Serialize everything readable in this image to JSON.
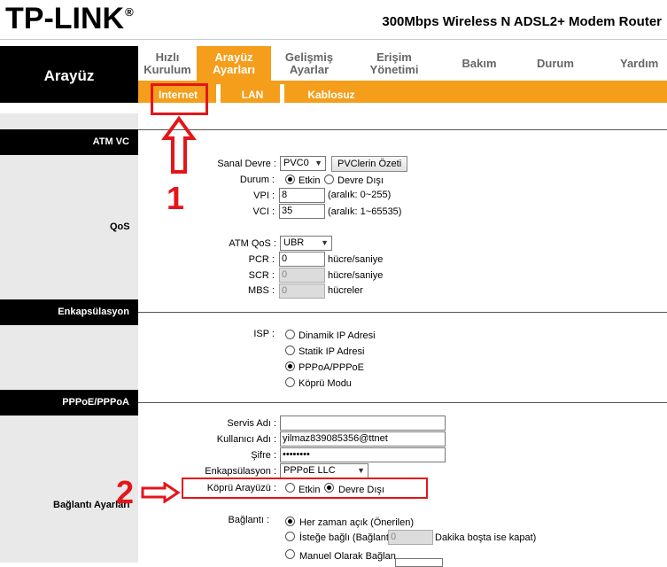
{
  "brand": {
    "logo": "TP-LINK",
    "reg": "®",
    "product": "300Mbps Wireless N ADSL2+ Modem Router"
  },
  "header": {
    "section_title": "Arayüz"
  },
  "nav": [
    {
      "line1": "Hızlı",
      "line2": "Kurulum"
    },
    {
      "line1": "Arayüz",
      "line2": "Ayarları"
    },
    {
      "line1": "Gelişmiş",
      "line2": "Ayarlar"
    },
    {
      "line1": "Erişim",
      "line2": "Yönetimi"
    },
    {
      "line1": "Bakım",
      "line2": ""
    },
    {
      "line1": "Durum",
      "line2": ""
    },
    {
      "line1": "Yardım",
      "line2": ""
    }
  ],
  "subnav": [
    "Internet",
    "LAN",
    "Kablosuz"
  ],
  "sections": {
    "atm": "ATM VC",
    "qos": "QoS",
    "encap": "Enkapsülasyon",
    "pppoe": "PPPoE/PPPoA",
    "conn": "Bağlantı Ayarları"
  },
  "atm": {
    "vc_label": "Sanal Devre :",
    "vc_value": "PVC0",
    "vc_button": "PVClerin Özeti",
    "status_label": "Durum :",
    "status_on": "Etkin",
    "status_off": "Devre Dışı",
    "vpi_label": "VPI :",
    "vpi_value": "8",
    "vpi_range": "(aralık: 0~255)",
    "vci_label": "VCI :",
    "vci_value": "35",
    "vci_range": "(aralık: 1~65535)"
  },
  "qos": {
    "atmqos_label": "ATM QoS :",
    "atmqos_value": "UBR",
    "pcr_label": "PCR :",
    "pcr_value": "0",
    "pcr_unit": "hücre/saniye",
    "scr_label": "SCR :",
    "scr_value": "0",
    "scr_unit": "hücre/saniye",
    "mbs_label": "MBS :",
    "mbs_value": "0",
    "mbs_unit": "hücreler"
  },
  "isp": {
    "label": "ISP :",
    "options": [
      "Dinamik IP Adresi",
      "Statik IP Adresi",
      "PPPoA/PPPoE",
      "Köprü Modu"
    ]
  },
  "pppoe": {
    "service_label": "Servis Adı :",
    "service_value": "",
    "user_label": "Kullanıcı Adı :",
    "user_value": "yilmaz839085356@ttnet",
    "pass_label": "Şifre :",
    "pass_value": "••••••••",
    "encap_label": "Enkapsülasyon :",
    "encap_value": "PPPoE LLC",
    "bridge_label": "Köprü Arayüzü :",
    "bridge_on": "Etkin",
    "bridge_off": "Devre Dışı"
  },
  "conn": {
    "label": "Bağlantı :",
    "always": "Her zaman açık (Önerilen)",
    "ondemand_pre": "İsteğe bağlı (Bağlantı",
    "ondemand_value": "0",
    "ondemand_post": "Dakika boşta ise kapat)",
    "manual": "Manuel Olarak Bağlan"
  },
  "annotations": {
    "step1": "1",
    "step2": "2"
  },
  "colors": {
    "accent": "#f49e1b",
    "annotation": "#e3161b",
    "left_bg": "#e9e9e9"
  }
}
